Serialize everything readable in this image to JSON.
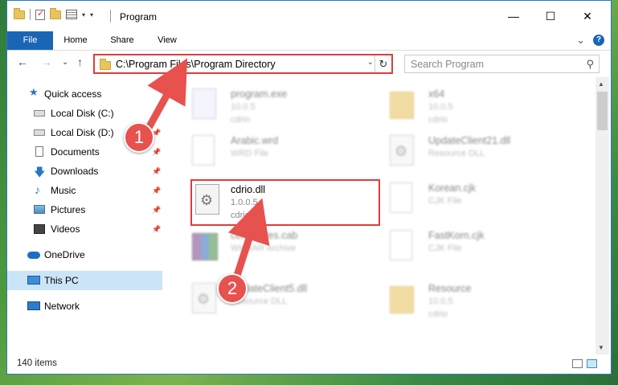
{
  "window": {
    "title": "Program",
    "controls": {
      "minimize": "—",
      "maximize": "☐",
      "close": "✕"
    }
  },
  "ribbon": {
    "tabs": [
      "File",
      "Home",
      "Share",
      "View"
    ],
    "expand_glyph": "⌄",
    "help_glyph": "?"
  },
  "nav": {
    "back_glyph": "←",
    "forward_glyph": "→",
    "recent_glyph": "⌄",
    "up_glyph": "↑",
    "address": "C:\\Program Files\\Program Directory",
    "search_placeholder": "Search Program"
  },
  "sidebar": {
    "items": [
      {
        "label": "Quick access",
        "icon": "star-icon",
        "pinned": false
      },
      {
        "label": "Local Disk (C:)",
        "icon": "disk-icon",
        "pinned": true
      },
      {
        "label": "Local Disk (D:)",
        "icon": "disk-icon",
        "pinned": true
      },
      {
        "label": "Documents",
        "icon": "documents-icon",
        "pinned": true
      },
      {
        "label": "Downloads",
        "icon": "downloads-icon",
        "pinned": true
      },
      {
        "label": "Music",
        "icon": "music-icon",
        "pinned": true
      },
      {
        "label": "Pictures",
        "icon": "pictures-icon",
        "pinned": true
      },
      {
        "label": "Videos",
        "icon": "videos-icon",
        "pinned": true
      },
      {
        "label": "OneDrive",
        "icon": "onedrive-icon",
        "pinned": false
      },
      {
        "label": "This PC",
        "icon": "this-pc-icon",
        "pinned": false,
        "selected": true
      },
      {
        "label": "Network",
        "icon": "network-icon",
        "pinned": false
      }
    ]
  },
  "files": [
    {
      "name": "program.exe",
      "line2": "10.0.5",
      "line3": "cdrio"
    },
    {
      "name": "x64",
      "line2": "10.0.5",
      "line3": "cdrio"
    },
    {
      "name": "Arabic.wrd",
      "line2": "WRD File",
      "line3": ""
    },
    {
      "name": "UpdateClient21.dll",
      "line2": "Resource DLL",
      "line3": ""
    },
    {
      "name": "cdrio.dll",
      "line2": "1.0.0.5",
      "line3": "cdrio"
    },
    {
      "name": "Korean.cjk",
      "line2": "CJK File",
      "line3": ""
    },
    {
      "name": "certificates.cab",
      "line2": "WinRAR Archive",
      "line3": ""
    },
    {
      "name": "FastKorn.cjk",
      "line2": "CJK File",
      "line3": ""
    },
    {
      "name": "UpdateClient5.dll",
      "line2": "Resource DLL",
      "line3": ""
    },
    {
      "name": "Resource",
      "line2": "10.0.5",
      "line3": "cdrio"
    }
  ],
  "status": {
    "item_count": "140 items"
  },
  "annotations": {
    "step1": "1",
    "step2": "2"
  },
  "colors": {
    "accent": "#1b65b6",
    "highlight": "#e03c3c",
    "badge": "#e8524e"
  }
}
